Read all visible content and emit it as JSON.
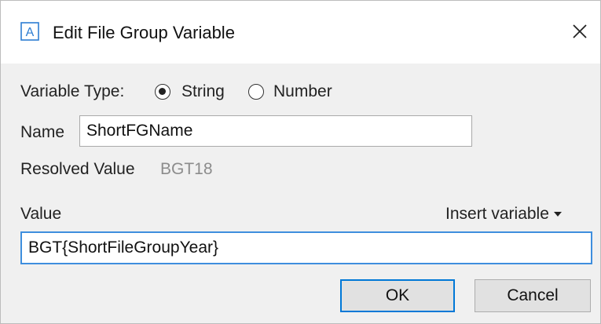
{
  "window": {
    "title": "Edit File Group Variable",
    "app_icon_letter": "A",
    "icon_color": "#2d7dd2"
  },
  "form": {
    "variable_type_label": "Variable Type:",
    "variable_type_options": [
      {
        "label": "String",
        "selected": true
      },
      {
        "label": "Number",
        "selected": false
      }
    ],
    "name_label": "Name",
    "name_value": "ShortFGName",
    "resolved_value_label": "Resolved Value",
    "resolved_value": "BGT18",
    "value_label": "Value",
    "insert_variable_label": "Insert variable",
    "value_value": "BGT{ShortFileGroupYear}"
  },
  "buttons": {
    "ok_label": "OK",
    "cancel_label": "Cancel"
  }
}
